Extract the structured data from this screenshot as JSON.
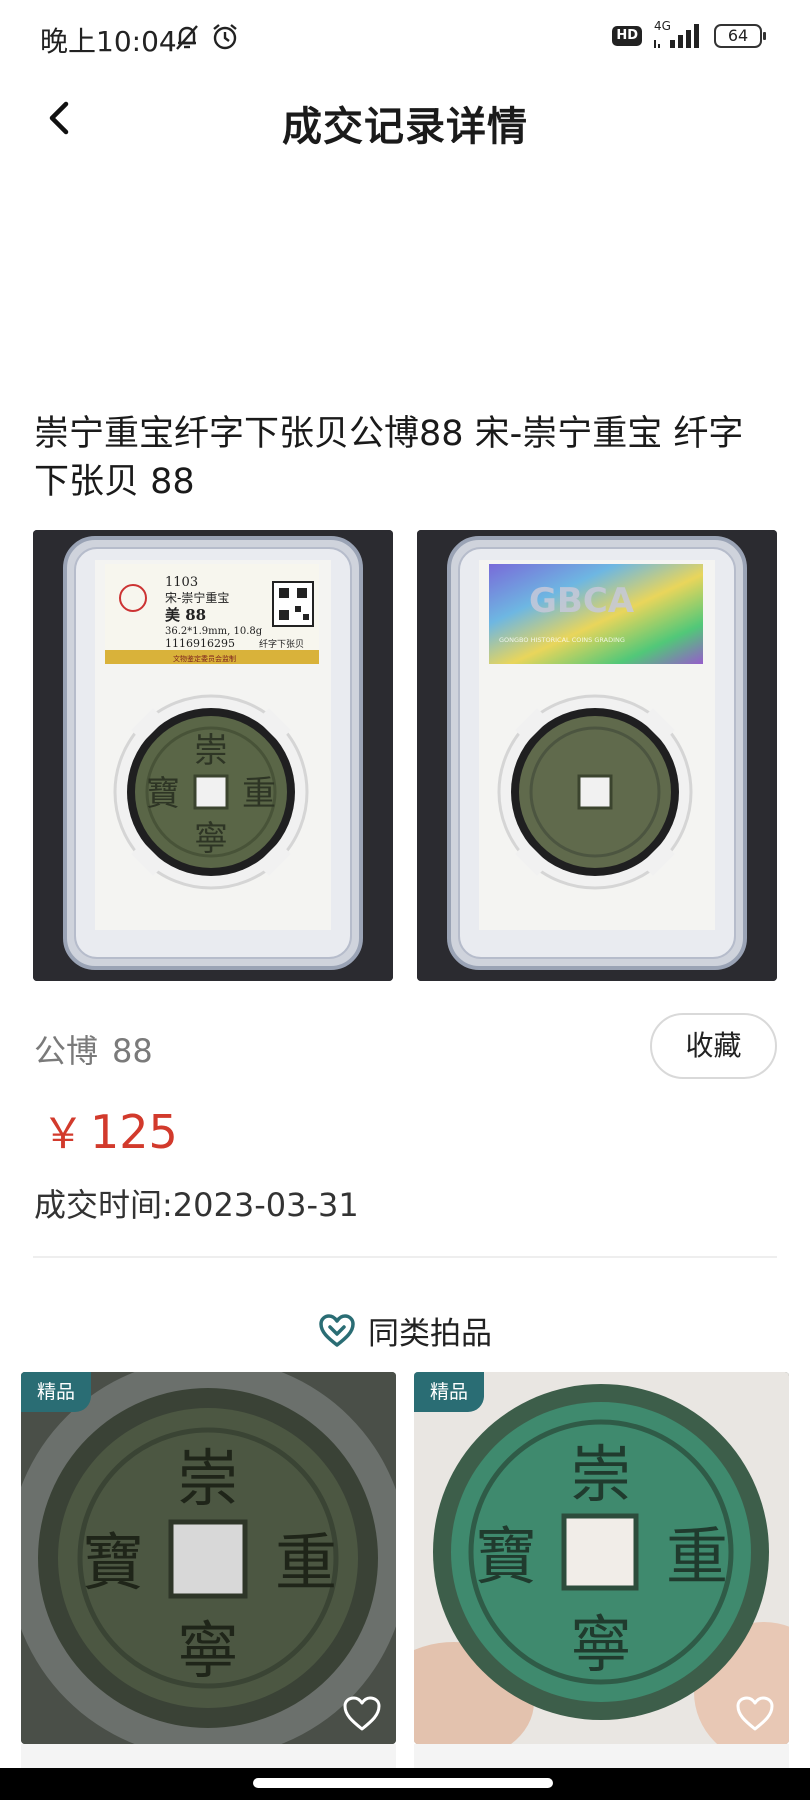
{
  "status_bar": {
    "time": "晚上10:04",
    "hd_label": "HD",
    "network": "4G",
    "battery": "64"
  },
  "nav": {
    "title": "成交记录详情"
  },
  "item": {
    "title": "崇宁重宝纤字下张贝公博88 宋-崇宁重宝 纤字下张贝 88",
    "grader": "公博",
    "grade": "88",
    "price_currency": "￥",
    "price": "125",
    "deal_time": "成交时间:2023-03-31"
  },
  "slab": {
    "cert_code": "1103",
    "coin_name": "宋-崇宁重宝",
    "grade_text": "美 88",
    "spec": "36.2*1.9mm, 10.8g",
    "serial": "1116916295",
    "variety": "纤字下张贝",
    "footer": "文物鉴定委员会监制",
    "brand": "GBCA",
    "brand_line": "GONGBO HISTORICAL COINS GRADING"
  },
  "coin_chars": {
    "top": "崇",
    "right": "重",
    "bottom": "寧",
    "left": "寶"
  },
  "actions": {
    "favorite_label": "收藏"
  },
  "similar": {
    "heading": "同类拍品",
    "items": [
      {
        "badge": "精品"
      },
      {
        "badge": "精品"
      }
    ]
  },
  "colors": {
    "price": "#d23a2c",
    "badge": "#2a6d74",
    "heart": "#2a6d74"
  },
  "icons": [
    "back-chevron-icon",
    "mute-bell-icon",
    "alarm-icon",
    "signal-icon",
    "battery-icon",
    "heart-outline-icon"
  ]
}
